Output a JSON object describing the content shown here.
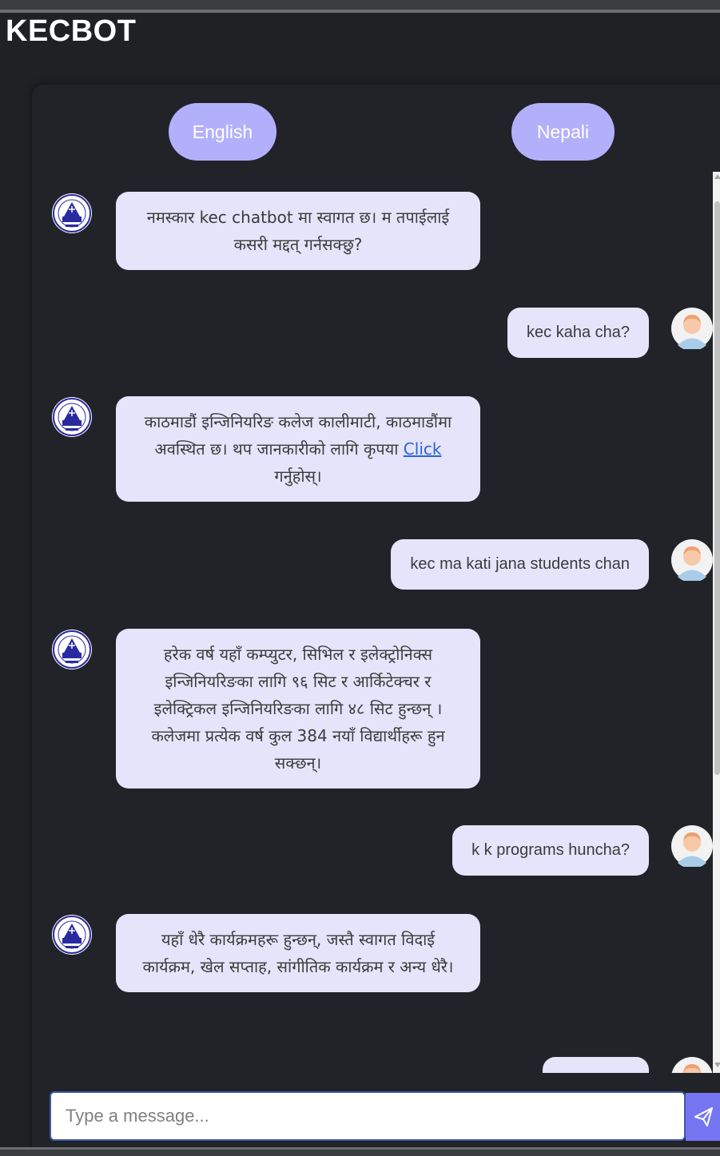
{
  "app": {
    "title": "KECBOT"
  },
  "language_buttons": {
    "english": "English",
    "nepali": "Nepali"
  },
  "messages": [
    {
      "sender": "bot",
      "text": "नमस्कार kec chatbot मा स्वागत छ। म तपाईलाई कसरी मद्दत् गर्नसक्छु?"
    },
    {
      "sender": "user",
      "text": "kec kaha cha?"
    },
    {
      "sender": "bot",
      "text_before_link": "काठमाडौं इन्जिनियरिङ कलेज कालीमाटी, काठमाडौंमा अवस्थित छ। थप जानकारीको लागि कृपया ",
      "link_text": "Click",
      "text_after_link": " गर्नुहोस्।"
    },
    {
      "sender": "user",
      "text": "kec ma kati jana students chan"
    },
    {
      "sender": "bot",
      "text": "हरेक वर्ष यहाँ कम्प्युटर, सिभिल र इलेक्ट्रोनिक्स इन्जिनियरिङका लागि ९६ सिट र आर्किटेक्चर र इलेक्ट्रिकल इन्जिनियरिङका लागि ४८ सिट हुन्छन् । कलेजमा प्रत्येक वर्ष कुल 384 नयाँ विद्यार्थीहरू हुन सक्छन्।"
    },
    {
      "sender": "user",
      "text": "k k programs huncha?"
    },
    {
      "sender": "bot",
      "text": "यहाँ धेरै कार्यक्रमहरू हुन्छन्, जस्तै स्वागत विदाई कार्यक्रम, खेल सप्ताह, सांगीतिक कार्यक्रम र अन्य धेरै।"
    },
    {
      "sender": "user",
      "text": ""
    }
  ],
  "composer": {
    "placeholder": "Type a message..."
  },
  "icons": {
    "bot_avatar": "college-logo-icon",
    "user_avatar": "user-avatar-icon",
    "send": "paper-plane-icon"
  },
  "colors": {
    "background": "#1f2125",
    "card": "#212328",
    "language_button": "#b3b0fb",
    "bubble": "#e6e4fb",
    "link": "#2b63d6",
    "send_button": "#7676f3"
  }
}
